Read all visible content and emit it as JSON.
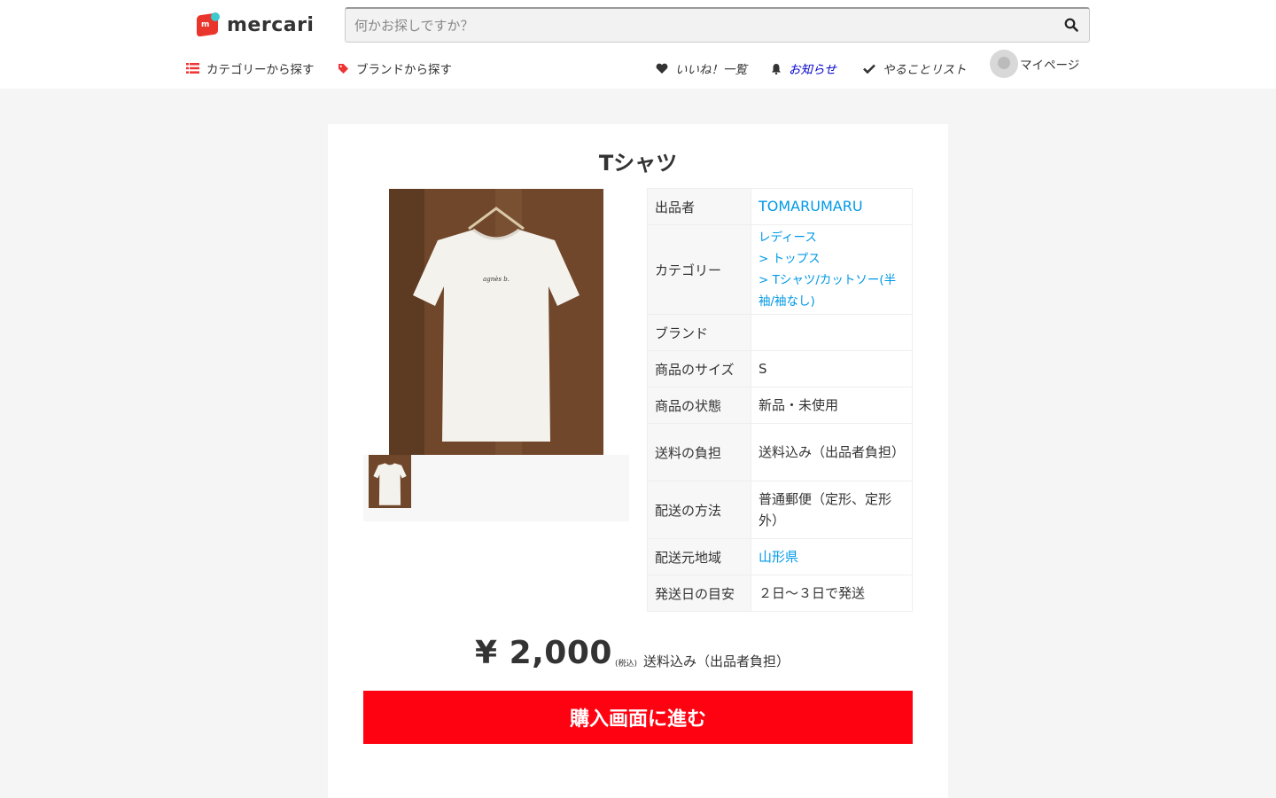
{
  "header": {
    "logo_text": "mercari",
    "search": {
      "placeholder": "何かお探しですか？",
      "value": ""
    },
    "nav": {
      "category": "カテゴリーから探す",
      "brand": "ブランドから探す",
      "likes": "いいね！一覧",
      "notifications": "お知らせ",
      "todo": "やることリスト",
      "mypage": "マイページ"
    }
  },
  "item": {
    "title": "Tシャツ",
    "photo_count": 1,
    "details": {
      "seller_label": "出品者",
      "seller": "TOMARUMARU",
      "category_label": "カテゴリー",
      "category_path": [
        "レディース",
        "> トップス",
        "> Tシャツ/カットソー(半袖/袖なし)"
      ],
      "brand_label": "ブランド",
      "brand": "",
      "size_label": "商品のサイズ",
      "size": "S",
      "condition_label": "商品の状態",
      "condition": "新品・未使用",
      "shipping_fee_label": "送料の負担",
      "shipping_fee": "送料込み（出品者負担）",
      "shipping_method_label": "配送の方法",
      "shipping_method": "普通郵便（定形、定形外）",
      "ship_from_label": "配送元地域",
      "ship_from": "山形県",
      "ship_days_label": "発送日の目安",
      "ship_days": "２日〜３日で発送"
    },
    "price": "¥ 2,000",
    "tax_note": "(税込)",
    "price_shipping": "送料込み（出品者負担）",
    "buy_button": "購入画面に進む"
  },
  "colors": {
    "brand_red": "#ff0211",
    "link_blue": "#0099e8",
    "notice_blue": "#0000cc"
  },
  "icons": [
    "search-icon",
    "list-icon",
    "tag-icon",
    "heart-icon",
    "bell-icon",
    "check-icon",
    "avatar"
  ]
}
